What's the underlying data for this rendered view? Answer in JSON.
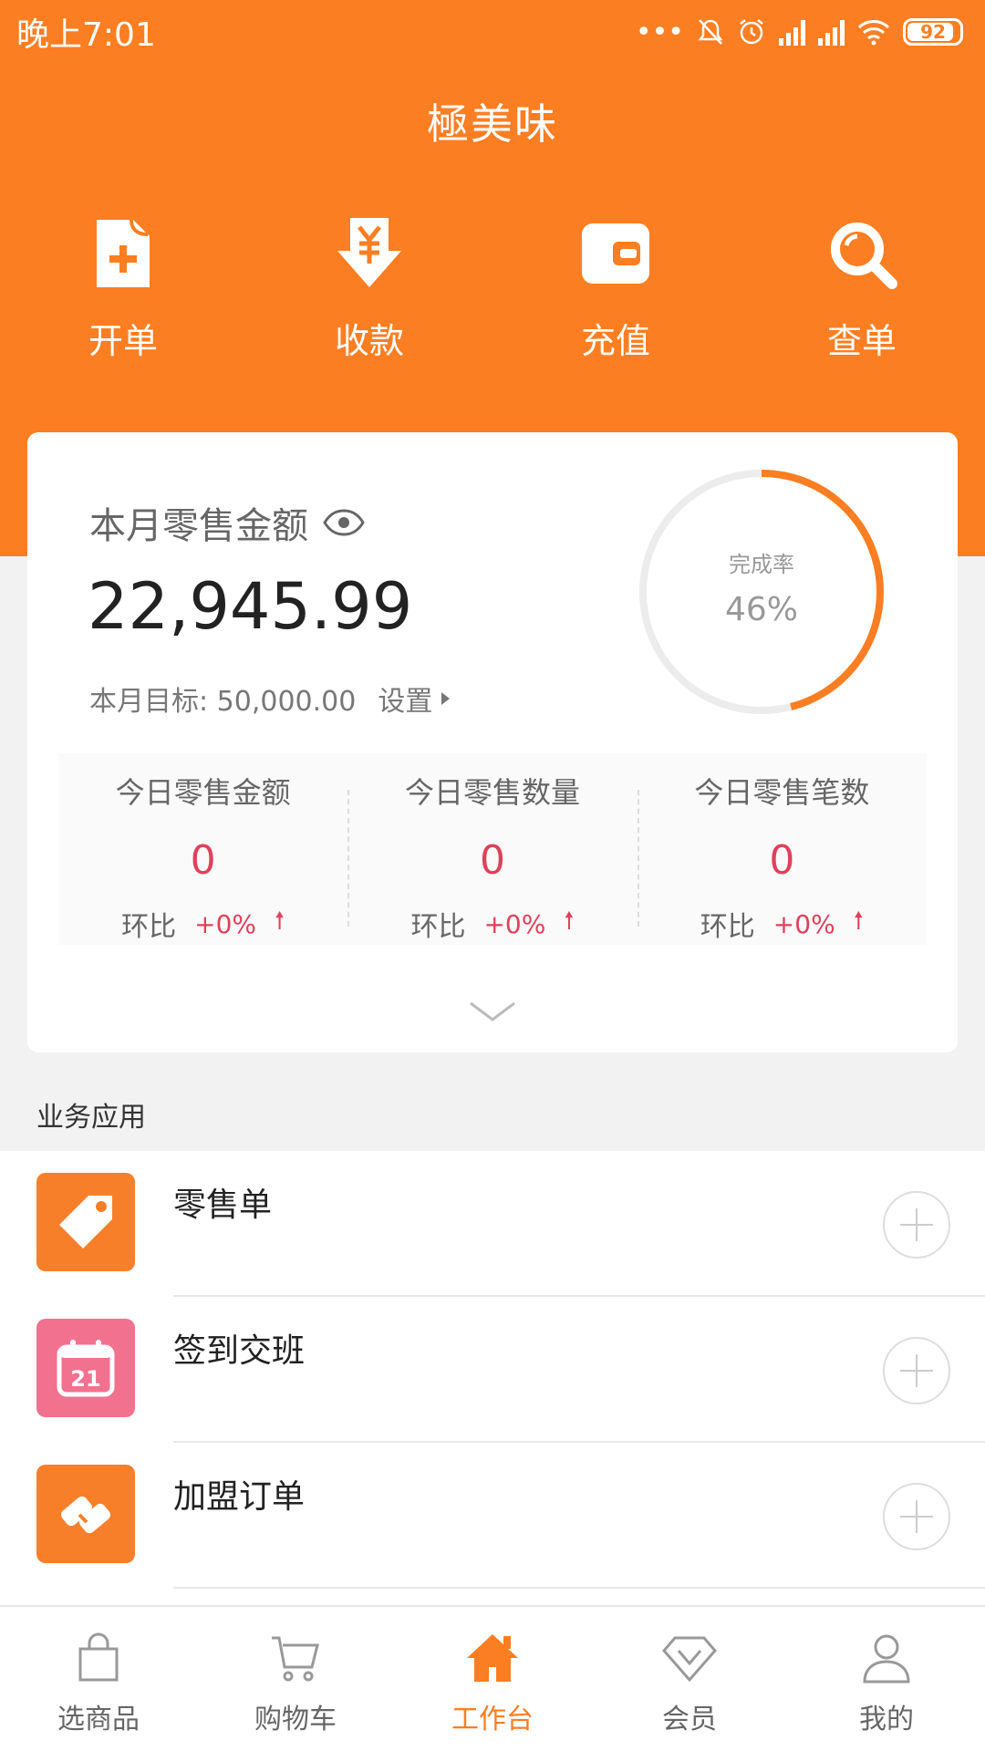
{
  "status_bar": {
    "time": "晚上7:01",
    "dots": "•••",
    "battery": "92"
  },
  "header": {
    "title": "極美味"
  },
  "quick_actions": [
    {
      "label": "开单",
      "icon": "new-order-icon"
    },
    {
      "label": "收款",
      "icon": "yuan-receive-icon"
    },
    {
      "label": "充值",
      "icon": "wallet-icon"
    },
    {
      "label": "查单",
      "icon": "search-icon"
    }
  ],
  "summary": {
    "month_label": "本月零售金额",
    "month_amount": "22,945.99",
    "target_label": "本月目标: 50,000.00",
    "set_label": "设置",
    "completion_label": "完成率",
    "completion_value": "46%",
    "completion_fraction": 0.46,
    "today": [
      {
        "title": "今日零售金额",
        "value": "0",
        "ratio_label": "环比",
        "ratio_value": "+0%"
      },
      {
        "title": "今日零售数量",
        "value": "0",
        "ratio_label": "环比",
        "ratio_value": "+0%"
      },
      {
        "title": "今日零售笔数",
        "value": "0",
        "ratio_label": "环比",
        "ratio_value": "+0%"
      }
    ]
  },
  "apps": {
    "section_title": "业务应用",
    "items": [
      {
        "name": "零售单",
        "icon": "price-tag-icon",
        "color": "#f77f2a"
      },
      {
        "name": "签到交班",
        "icon": "calendar-icon",
        "color": "#f2718f",
        "icon_text": "21"
      },
      {
        "name": "加盟订单",
        "icon": "handshake-icon",
        "color": "#f77f2a"
      }
    ]
  },
  "bottom_nav": [
    {
      "label": "选商品",
      "icon": "shopping-bag-icon",
      "active": false
    },
    {
      "label": "购物车",
      "icon": "cart-icon",
      "active": false
    },
    {
      "label": "工作台",
      "icon": "home-icon",
      "active": true
    },
    {
      "label": "会员",
      "icon": "diamond-icon",
      "active": false
    },
    {
      "label": "我的",
      "icon": "user-icon",
      "active": false
    }
  ],
  "colors": {
    "brand": "#fb7e22",
    "accent_red": "#e0405a"
  }
}
